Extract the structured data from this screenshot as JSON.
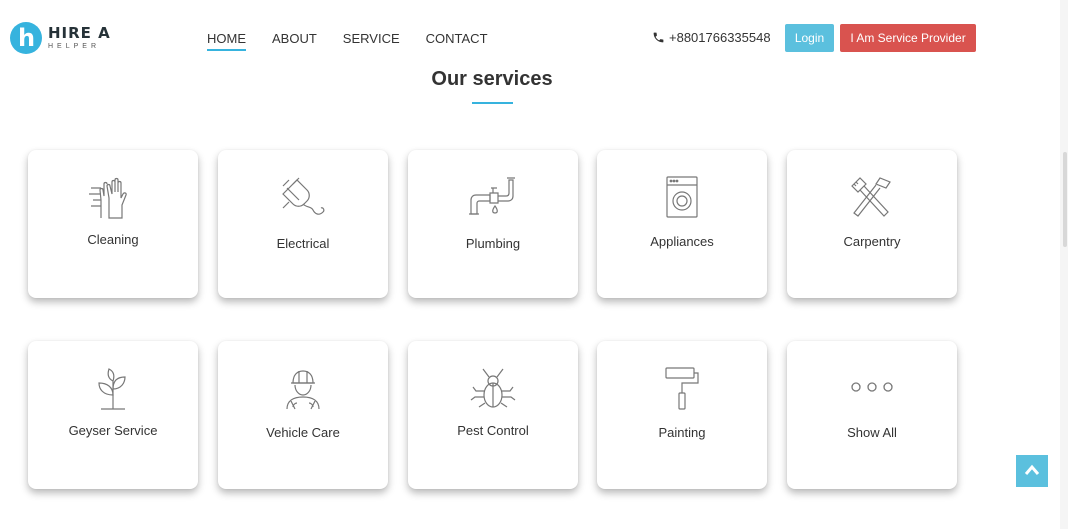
{
  "brand": {
    "line1": "HIRE A",
    "line2": "HELPER",
    "mark": "h"
  },
  "nav": [
    {
      "label": "HOME",
      "active": true
    },
    {
      "label": "ABOUT"
    },
    {
      "label": "SERVICE"
    },
    {
      "label": "CONTACT"
    }
  ],
  "header": {
    "phone": "+8801766335548",
    "phone_icon": "phone-icon",
    "login_label": "Login",
    "provider_label": "I Am Service Provider"
  },
  "section": {
    "title": "Our services"
  },
  "services": [
    {
      "label": "Cleaning",
      "icon": "gloves-icon"
    },
    {
      "label": "Electrical",
      "icon": "plug-icon"
    },
    {
      "label": "Plumbing",
      "icon": "pipe-icon"
    },
    {
      "label": "Appliances",
      "icon": "washing-machine-icon"
    },
    {
      "label": "Carpentry",
      "icon": "tools-icon"
    },
    {
      "label": "Geyser Service",
      "icon": "plant-icon"
    },
    {
      "label": "Vehicle Care",
      "icon": "mechanic-icon"
    },
    {
      "label": "Pest Control",
      "icon": "bug-icon"
    },
    {
      "label": "Painting",
      "icon": "paint-roller-icon"
    },
    {
      "label": "Show All",
      "icon": "more-icon"
    }
  ],
  "colors": {
    "accent": "#36b3de",
    "login": "#5bc0de",
    "provider": "#d9534f"
  }
}
